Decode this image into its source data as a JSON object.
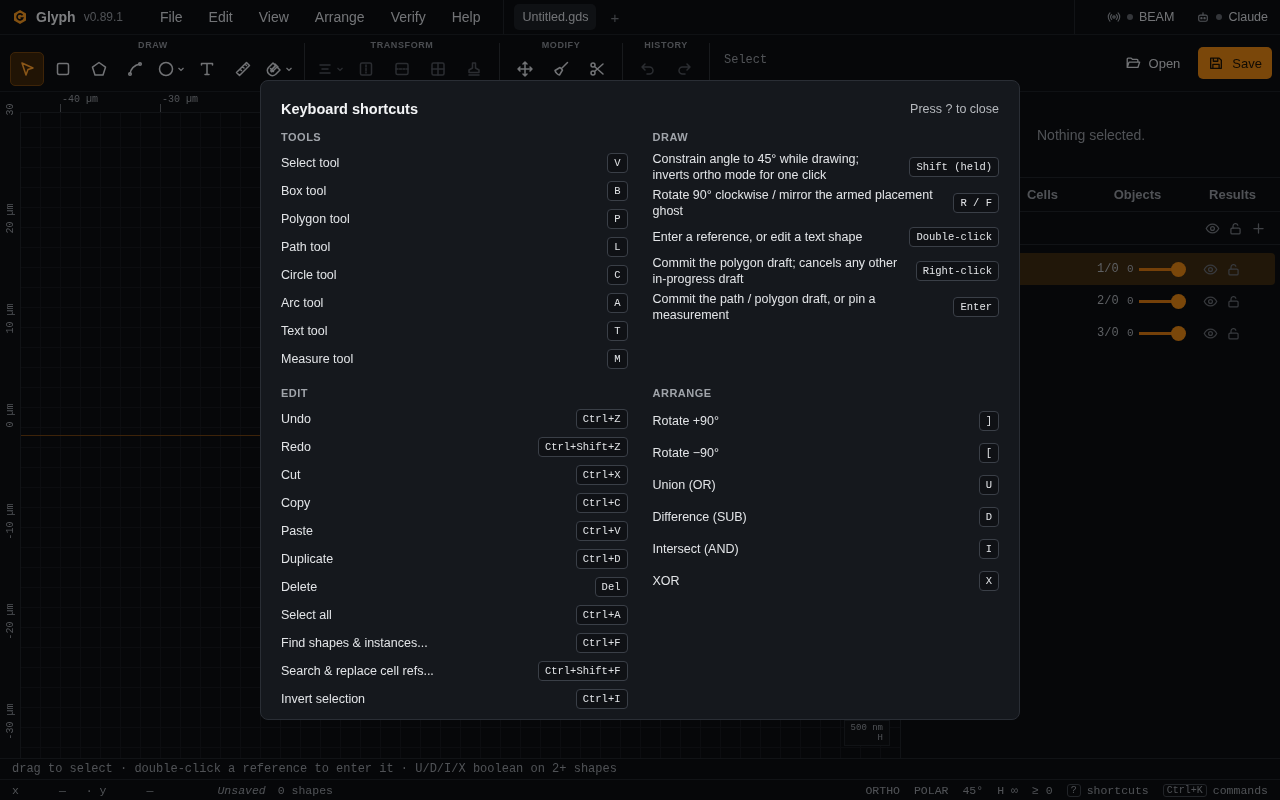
{
  "app": {
    "name": "Glyph",
    "version": "v0.89.1"
  },
  "menu": [
    "File",
    "Edit",
    "View",
    "Arrange",
    "Verify",
    "Help"
  ],
  "doc_tab": "Untitled.gds",
  "new_tab": "+",
  "indicators": [
    {
      "kind": "beam",
      "label": "BEAM",
      "connected": false
    },
    {
      "kind": "assistant",
      "label": "Claude",
      "connected": false
    }
  ],
  "toolbar": {
    "groups": [
      {
        "label": "DRAW",
        "tools": [
          {
            "kind": "select",
            "selected": true,
            "disabled": false,
            "dropdown": false
          },
          {
            "kind": "rect",
            "selected": false,
            "disabled": false,
            "dropdown": false
          },
          {
            "kind": "polygon",
            "selected": false,
            "disabled": false,
            "dropdown": false
          },
          {
            "kind": "path",
            "selected": false,
            "disabled": false,
            "dropdown": false
          },
          {
            "kind": "circle",
            "selected": false,
            "disabled": false,
            "dropdown": true
          },
          {
            "kind": "text",
            "selected": false,
            "disabled": false,
            "dropdown": false
          },
          {
            "kind": "ruler",
            "selected": false,
            "disabled": false,
            "dropdown": false
          },
          {
            "kind": "magnet",
            "selected": false,
            "disabled": false,
            "dropdown": true
          }
        ]
      },
      {
        "label": "TRANSFORM",
        "tools": [
          {
            "kind": "align",
            "selected": false,
            "disabled": true,
            "dropdown": true
          },
          {
            "kind": "frame",
            "selected": false,
            "disabled": true,
            "dropdown": false
          },
          {
            "kind": "split",
            "selected": false,
            "disabled": true,
            "dropdown": false
          },
          {
            "kind": "grid",
            "selected": false,
            "disabled": true,
            "dropdown": false
          },
          {
            "kind": "stamp",
            "selected": false,
            "disabled": true,
            "dropdown": false
          }
        ]
      },
      {
        "label": "MODIFY",
        "tools": [
          {
            "kind": "move",
            "selected": false,
            "disabled": false,
            "dropdown": false
          },
          {
            "kind": "brush",
            "selected": false,
            "disabled": false,
            "dropdown": false
          },
          {
            "kind": "scissors",
            "selected": false,
            "disabled": false,
            "dropdown": false
          }
        ]
      },
      {
        "label": "HISTORY",
        "tools": [
          {
            "kind": "undo",
            "selected": false,
            "disabled": true,
            "dropdown": false
          },
          {
            "kind": "redo",
            "selected": false,
            "disabled": true,
            "dropdown": false
          }
        ]
      }
    ],
    "mode": "Select",
    "buttons": [
      {
        "kind": "open",
        "label": "Open"
      },
      {
        "kind": "save",
        "label": "Save"
      }
    ]
  },
  "canvas": {
    "x_ticks": [
      "-40 µm",
      "-30 µm"
    ],
    "y_ticks": [
      "30",
      "20 µm",
      "10 µm",
      "0 µm",
      "-10 µm",
      "-20 µm",
      "-30 µm"
    ],
    "scale": "500 nm",
    "scale_axis": "H"
  },
  "inspector": {
    "message": "Nothing selected.",
    "tabs": [
      {
        "label": "Cells"
      },
      {
        "label": "Objects"
      },
      {
        "label": "Results"
      }
    ],
    "layers": [
      {
        "name": "1/0",
        "count": "0",
        "level": 1,
        "selected": true,
        "visible": true,
        "locked": false
      },
      {
        "name": "2/0",
        "count": "0",
        "level": 1,
        "selected": false,
        "visible": true,
        "locked": false
      },
      {
        "name": "3/0",
        "count": "0",
        "level": 1,
        "selected": false,
        "visible": true,
        "locked": false
      }
    ]
  },
  "hint": "drag to select · double-click a reference to enter it · U/D/I/X boolean on 2+ shapes",
  "status_bar": {
    "left": [
      {
        "kind": "label",
        "text": "x"
      },
      {
        "kind": "value",
        "text": "—"
      },
      {
        "kind": "label",
        "text": "· y"
      },
      {
        "kind": "value",
        "text": "—"
      },
      {
        "kind": "state",
        "text": "Unsaved"
      },
      {
        "kind": "label",
        "text": "0 shapes"
      }
    ],
    "right": [
      {
        "kind": "label",
        "text": "ORTHO"
      },
      {
        "kind": "label",
        "text": "POLAR"
      },
      {
        "kind": "label",
        "text": "45°"
      },
      {
        "kind": "label",
        "text": "H ∞"
      },
      {
        "kind": "label",
        "text": "≥ 0"
      },
      {
        "kind": "key",
        "text": "?"
      },
      {
        "kind": "label",
        "text": "shortcuts"
      },
      {
        "kind": "key",
        "text": "Ctrl+K"
      },
      {
        "kind": "label",
        "text": "commands"
      }
    ]
  },
  "shortcuts": {
    "title": "Keyboard shortcuts",
    "close_hint": "Press ? to close",
    "sections": [
      {
        "title": "TOOLS",
        "items": [
          {
            "label": "Select tool",
            "key": "V"
          },
          {
            "label": "Box tool",
            "key": "B"
          },
          {
            "label": "Polygon tool",
            "key": "P"
          },
          {
            "label": "Path tool",
            "key": "L"
          },
          {
            "label": "Circle tool",
            "key": "C"
          },
          {
            "label": "Arc tool",
            "key": "A"
          },
          {
            "label": "Text tool",
            "key": "T"
          },
          {
            "label": "Measure tool",
            "key": "M"
          }
        ]
      },
      {
        "title": "DRAW",
        "items": [
          {
            "label": "Constrain angle to 45° while drawing; inverts ortho mode for one click",
            "key": "Shift (held)"
          },
          {
            "label": "Rotate 90° clockwise / mirror the armed placement ghost",
            "key": "R / F"
          },
          {
            "label": "Enter a reference, or edit a text shape",
            "key": "Double-click"
          },
          {
            "label": "Commit the polygon draft; cancels any other in-progress draft",
            "key": "Right-click"
          },
          {
            "label": "Commit the path / polygon draft, or pin a measurement",
            "key": "Enter"
          }
        ]
      },
      {
        "title": "EDIT",
        "items": [
          {
            "label": "Undo",
            "key": "Ctrl+Z"
          },
          {
            "label": "Redo",
            "key": "Ctrl+Shift+Z"
          },
          {
            "label": "Cut",
            "key": "Ctrl+X"
          },
          {
            "label": "Copy",
            "key": "Ctrl+C"
          },
          {
            "label": "Paste",
            "key": "Ctrl+V"
          },
          {
            "label": "Duplicate",
            "key": "Ctrl+D"
          },
          {
            "label": "Delete",
            "key": "Del"
          },
          {
            "label": "Select all",
            "key": "Ctrl+A"
          },
          {
            "label": "Find shapes & instances...",
            "key": "Ctrl+F"
          },
          {
            "label": "Search & replace cell refs...",
            "key": "Ctrl+Shift+F"
          },
          {
            "label": "Invert selection",
            "key": "Ctrl+I"
          }
        ]
      },
      {
        "title": "ARRANGE",
        "items": [
          {
            "label": "Rotate +90°",
            "key": "]"
          },
          {
            "label": "Rotate −90°",
            "key": "["
          },
          {
            "label": "Union (OR)",
            "key": "U"
          },
          {
            "label": "Difference (SUB)",
            "key": "D"
          },
          {
            "label": "Intersect (AND)",
            "key": "I"
          },
          {
            "label": "XOR",
            "key": "X"
          }
        ]
      }
    ]
  }
}
